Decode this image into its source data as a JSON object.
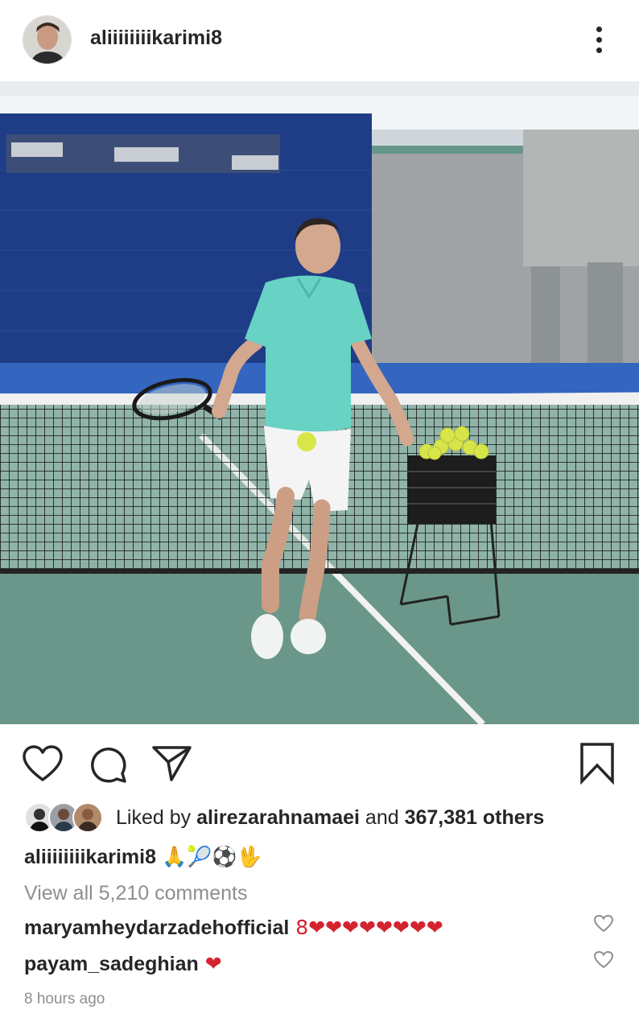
{
  "post": {
    "username": "aliiiiiiiikarimi8",
    "caption_username": "aliiiiiiiikarimi8",
    "caption_emojis": "🙏🎾⚽🖖",
    "likes_prefix": "Liked by ",
    "liked_by": "alirezarahnamaei",
    "likes_and": " and ",
    "likes_count": "367,381 others",
    "view_all_comments": "View all 5,210 comments",
    "timestamp": "8 hours ago"
  },
  "comments": [
    {
      "username": "maryamheydarzadehofficial",
      "text": " 8❤❤❤❤❤❤❤❤"
    },
    {
      "username": "payam_sadeghian",
      "text": " ❤"
    }
  ],
  "icons": {
    "more": "more-vertical-icon",
    "like": "heart-icon",
    "comment": "comment-icon",
    "share": "send-icon",
    "save": "bookmark-icon",
    "user_tag": "person-icon"
  },
  "colors": {
    "text": "#262626",
    "secondary_text": "#8e8e8e",
    "heart_red": "#d4232f"
  }
}
